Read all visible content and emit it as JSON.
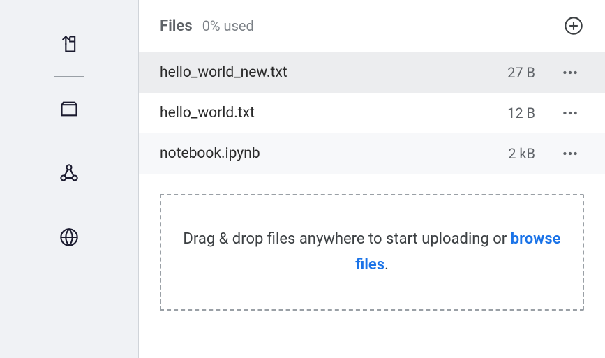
{
  "header": {
    "title": "Files",
    "usage": "0% used"
  },
  "files": [
    {
      "name": "hello_world_new.txt",
      "size": "27 B",
      "selected": true,
      "alt": false
    },
    {
      "name": "hello_world.txt",
      "size": "12 B",
      "selected": false,
      "alt": false
    },
    {
      "name": "notebook.ipynb",
      "size": "2 kB",
      "selected": false,
      "alt": true
    }
  ],
  "dropzone": {
    "text_prefix": "Drag & drop files anywhere to start uploading or ",
    "browse_label": "browse files",
    "text_suffix": "."
  }
}
